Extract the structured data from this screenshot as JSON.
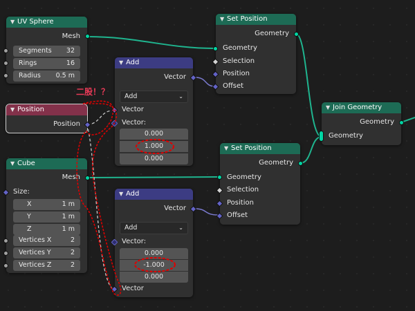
{
  "colors": {
    "geometry_header": "#1d6b55",
    "input_header": "#83314a",
    "vector_header": "#3c3c83",
    "geometry_socket": "#00d6a3",
    "vector_socket": "#6363c7",
    "annotation_red": "#e00000"
  },
  "uv_sphere": {
    "title": "UV Sphere",
    "output_mesh": "Mesh",
    "segments_label": "Segments",
    "segments_value": "32",
    "rings_label": "Rings",
    "rings_value": "16",
    "radius_label": "Radius",
    "radius_value": "0.5 m"
  },
  "position": {
    "title": "Position",
    "output": "Position"
  },
  "cube": {
    "title": "Cube",
    "output_mesh": "Mesh",
    "size_label": "Size:",
    "x_label": "X",
    "x_value": "1 m",
    "y_label": "Y",
    "y_value": "1 m",
    "z_label": "Z",
    "z_value": "1 m",
    "vx_label": "Vertices X",
    "vx_value": "2",
    "vy_label": "Vertices Y",
    "vy_value": "2",
    "vz_label": "Vertices Z",
    "vz_value": "2"
  },
  "add_top": {
    "title": "Add",
    "output": "Vector",
    "operation": "Add",
    "input1": "Vector",
    "input2": "Vector:",
    "values": [
      "0.000",
      "1.000",
      "0.000"
    ]
  },
  "add_bottom": {
    "title": "Add",
    "output": "Vector",
    "operation": "Add",
    "input1": "Vector:",
    "input2": "Vector",
    "values": [
      "0.000",
      "-1.000",
      "0.000"
    ]
  },
  "set_position_top": {
    "title": "Set Position",
    "output": "Geometry",
    "in_geometry": "Geometry",
    "in_selection": "Selection",
    "in_position": "Position",
    "in_offset": "Offset"
  },
  "set_position_bottom": {
    "title": "Set Position",
    "output": "Geometry",
    "in_geometry": "Geometry",
    "in_selection": "Selection",
    "in_position": "Position",
    "in_offset": "Offset"
  },
  "join_geometry": {
    "title": "Join Geometry",
    "output": "Geometry",
    "input": "Geometry"
  },
  "annotation": {
    "text": "二股！？"
  },
  "icons": {
    "collapse": "chevron-down-icon",
    "dropdown": "chevron-down-icon"
  }
}
